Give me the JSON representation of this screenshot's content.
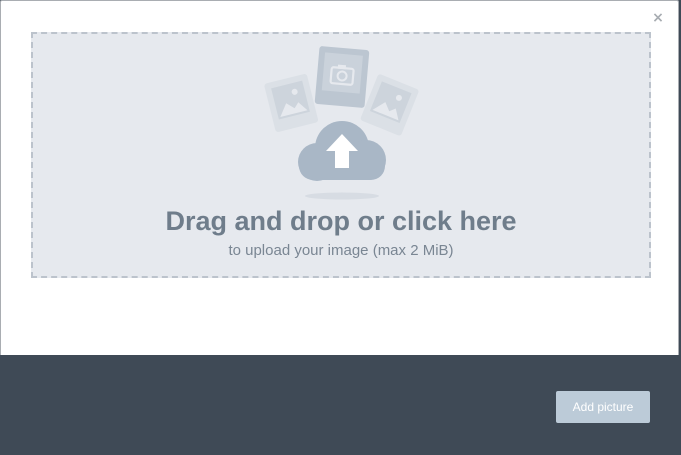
{
  "modal": {
    "close_glyph": "×"
  },
  "dropzone": {
    "title": "Drag and drop or click here",
    "subtitle": "to upload your image (max 2 MiB)",
    "icons": [
      "image-card-icon",
      "camera-card-icon",
      "image-card-icon",
      "upload-cloud-icon"
    ]
  },
  "footer": {
    "add_button_label": "Add picture"
  },
  "colors": {
    "footer_bg": "#3f4a56",
    "dropzone_bg": "#e6e9ee",
    "dropzone_border": "#bcc3cc",
    "title_text": "#6f7d8b",
    "cloud": "#a9b7c6",
    "button_bg": "#bccbd8"
  }
}
